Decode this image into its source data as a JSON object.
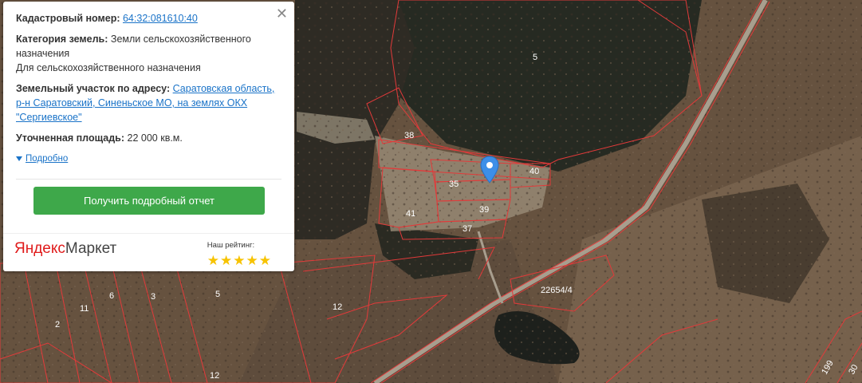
{
  "popup": {
    "cadastral_label": "Кадастровый номер:",
    "cadastral_value": "64:32:081610:40",
    "category_label": "Категория земель:",
    "category_value_1": "Земли сельскохозяйственного",
    "category_value_2": "назначения",
    "category_value_3": "Для сельскохозяйственного назначения",
    "address_label": "Земельный участок по адресу:",
    "address_value_1": "Саратовская область,",
    "address_value_2": "р-н Саратовский, Синеньское МО, на землях ОКХ",
    "address_value_3": "\"Сергиевское\"",
    "area_label": "Уточненная площадь:",
    "area_value": "22 000 кв.м.",
    "details_link": "Подробно",
    "report_button": "Получить подробный отчет",
    "brand_ya": "Яндекс",
    "brand_market": "Маркет",
    "rating_label": "Наш рейтинг:",
    "rating_stars": "★★★★★"
  },
  "map": {
    "plot_labels": [
      "5",
      "38",
      "40",
      "35",
      "39",
      "41",
      "37",
      "22654/4",
      "6",
      "3",
      "5",
      "11",
      "2",
      "12",
      "12",
      "199",
      "30"
    ]
  },
  "colors": {
    "plot_border": "#e23a3a",
    "button_green": "#3ea84a",
    "link_blue": "#1a73c8",
    "pin_blue": "#3d8fe8"
  }
}
